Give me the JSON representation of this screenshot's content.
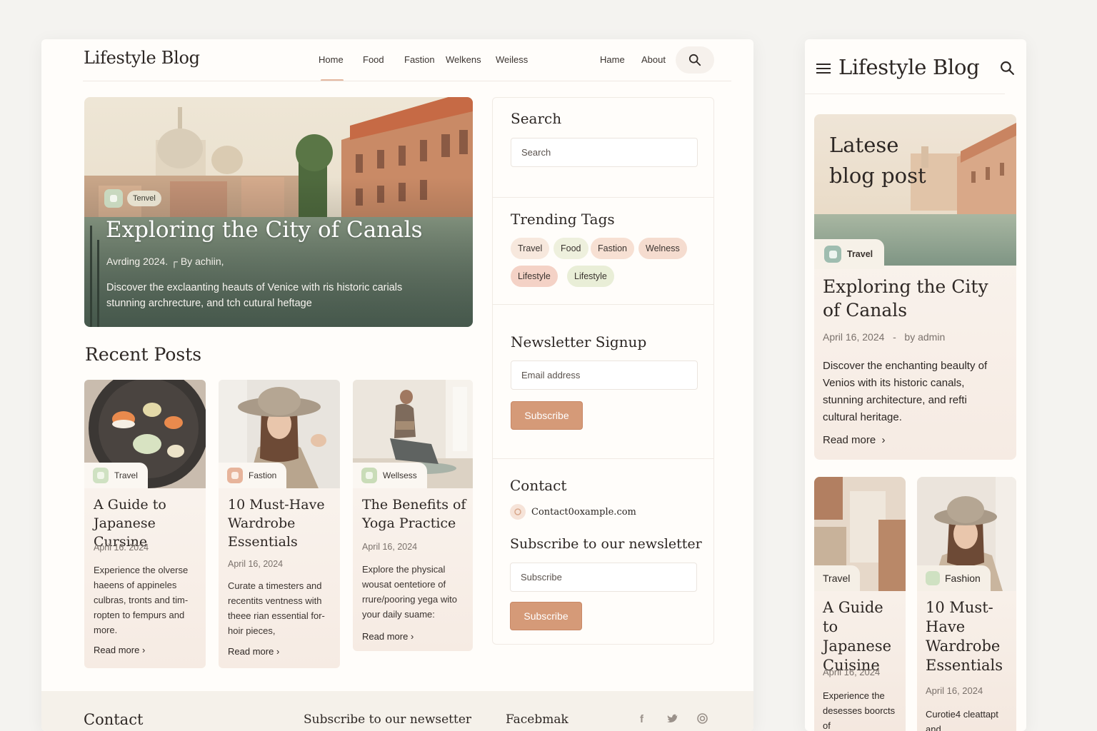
{
  "desktop": {
    "logo": "Lifestyle Blog",
    "nav": [
      "Home",
      "Food",
      "Fastion",
      "Welkens",
      "Weiless",
      "Hame",
      "About"
    ],
    "hero": {
      "category": "Tenvel",
      "title": "Exploring the City of Canals",
      "meta": "Avrding 2024.  ┌  By achiin,",
      "description": "Discover the exclaanting heauts of Venice with ris historic carials stunning archrecture, and tch cutural heftage"
    },
    "recent_heading": "Recent Posts",
    "posts": [
      {
        "category": "Travel",
        "title": "A Guide to Japanese Cursine",
        "date": "April  16. 2024",
        "excerpt": "Experience the olverse haeens of appineles culbras, tronts and tim-ropten to fempurs and more.",
        "read_more": "Read more"
      },
      {
        "category": "Fastion",
        "title": "10 Must-Have Wardrobe Essentials",
        "date": "April 16, 2024",
        "excerpt": "Curate a timesters and recentits ventness with theee rian essential for-hoir pieces,",
        "read_more": "Read more"
      },
      {
        "category": "Wellsess",
        "title": "The Benefits of Yoga Practice",
        "date": "April  16,  2024",
        "excerpt": "Explore the physical wousat oentetiore of rrure/pooring yega wito your daily suame:",
        "read_more": "Read more"
      }
    ],
    "sidebar": {
      "search_title": "Search",
      "search_placeholder": "Search",
      "tags_title": "Trending Tags",
      "tags": [
        {
          "label": "Travel",
          "color": "#f7e8dd"
        },
        {
          "label": "Food",
          "color": "#eef0dd"
        },
        {
          "label": "Fastion",
          "color": "#f7e0d3"
        },
        {
          "label": "Welness",
          "color": "#f5dccf"
        },
        {
          "label": "Lifestyle",
          "color": "#f4d2c6"
        },
        {
          "label": "Lifestyle",
          "color": "#e9eed7"
        }
      ],
      "newsletter_title": "Newsletter Signup",
      "email_placeholder": "Email address",
      "subscribe_label": "Subscribe",
      "contact_title": "Contact",
      "contact_email": "Contact0oxample.com",
      "subscribe_newsletter_title": "Subscribe to our newsletter",
      "subscribe_placeholder": "Subscribe",
      "subscribe_label_2": "Subscribe"
    },
    "footer": {
      "contact": "Contact",
      "subscribe": "Subscribe to our newsetter",
      "facebook": "Facebmak"
    }
  },
  "mobile": {
    "logo": "Lifestyle Blog",
    "hero_overlay": "Latese blog post",
    "hero_overlay_lines": [
      "Latese",
      "blog post"
    ],
    "featured": {
      "category": "Travel",
      "title": "Exploring the City of Canals",
      "date": "April 16, 2024",
      "separator": "-",
      "author": "by admin",
      "excerpt": "Discover the enchanting beaulty of Venios with its historic canals, stunning architecture, and refti cultural heritage.",
      "read_more": "Read more"
    },
    "cards": [
      {
        "category": "Travel",
        "title": "A Guide to Japanese Cuisine",
        "date": "April 16, 2024",
        "excerpt": "Experience the desesses boorcts of"
      },
      {
        "category": "Fashion",
        "title": "10 Must-Have Wardrobe Essentials",
        "date": "April 16, 2024",
        "excerpt": "Curotie4 cleattapt and"
      }
    ]
  },
  "icons": [
    "search-icon",
    "hamburger-icon",
    "chevron-right-icon",
    "facebook-icon",
    "twitter-icon",
    "instagram-icon",
    "mail-icon"
  ],
  "colors": {
    "accent": "#d59a78",
    "background": "#fffdfa",
    "text": "#2d2724"
  }
}
